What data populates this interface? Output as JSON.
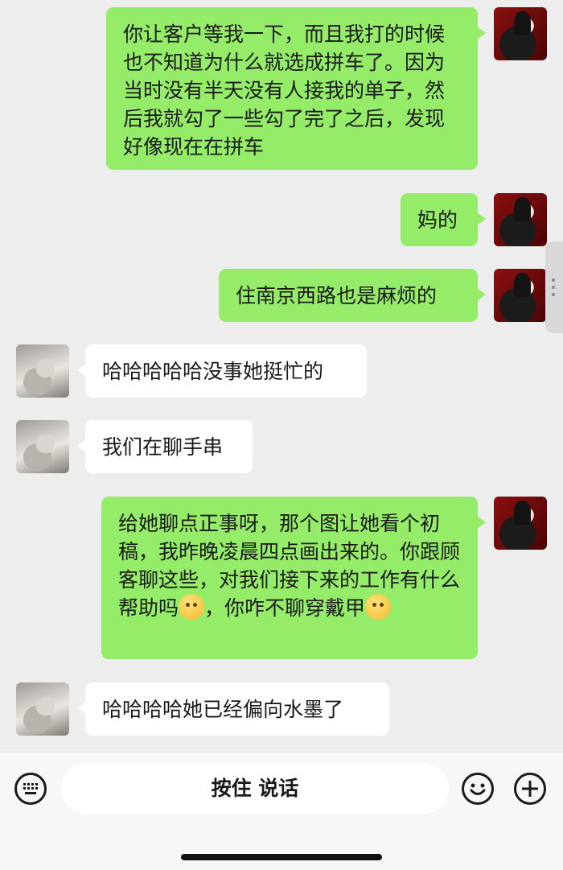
{
  "messages": [
    {
      "sender": "me",
      "text": "你让客户等我一下，而且我打的时候也不知道为什么就选成拼车了。因为当时没有半天没有人接我的单子，然后我就勾了一些勾了完了之后，发现好像现在在拼车"
    },
    {
      "sender": "me",
      "text": "妈的"
    },
    {
      "sender": "me",
      "text": "住南京西路也是麻烦的"
    },
    {
      "sender": "other",
      "text": "哈哈哈哈哈没事她挺忙的"
    },
    {
      "sender": "other",
      "text": "我们在聊手串"
    },
    {
      "sender": "me",
      "text_parts": [
        "给她聊点正事呀，那个图让她看个初稿，我昨晚凌晨四点画出来的。你跟顾客聊这些，对我们接下来的工作有什么帮助吗",
        "，你咋不聊穿戴甲"
      ],
      "emojis": [
        "flushed-face",
        "grimace-face"
      ]
    },
    {
      "sender": "other",
      "text": "哈哈哈哈她已经偏向水墨了"
    }
  ],
  "input_bar": {
    "voice_label": "按住 说话",
    "icons": [
      "keyboard-icon",
      "emoji-icon",
      "plus-icon"
    ]
  },
  "colors": {
    "background": "#ededed",
    "my_bubble": "#95ec69",
    "other_bubble": "#ffffff"
  }
}
